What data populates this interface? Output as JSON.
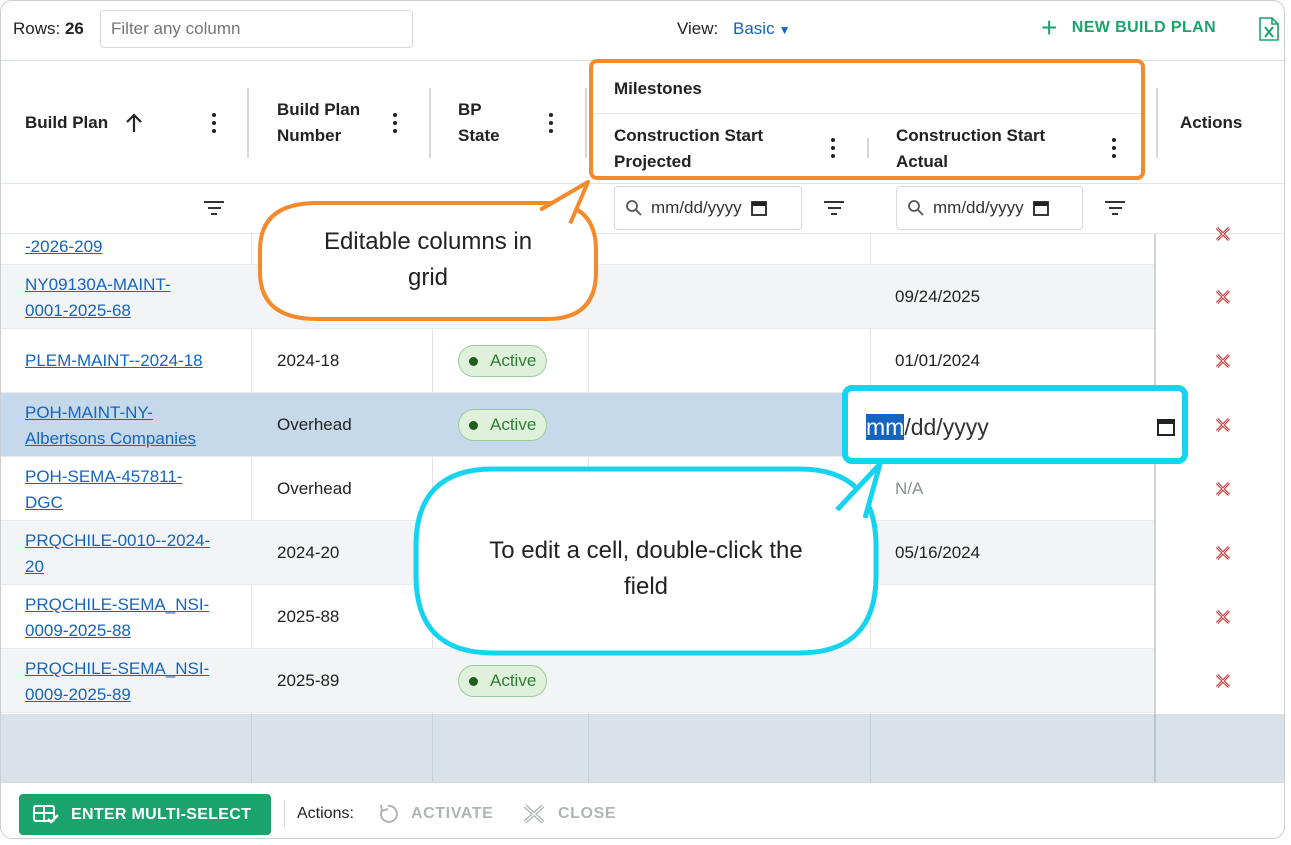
{
  "toolbar": {
    "rows_label": "Rows:",
    "rows_count": "26",
    "filter_placeholder": "Filter any column",
    "view_label": "View:",
    "view_value": "Basic",
    "new_build_label": "NEW BUILD PLAN"
  },
  "header": {
    "col_build_plan": "Build Plan",
    "col_build_plan_number_l1": "Build Plan",
    "col_build_plan_number_l2": "Number",
    "col_bp_state_l1": "BP",
    "col_bp_state_l2": "State",
    "group_milestones": "Milestones",
    "col_cs_projected_l1": "Construction Start",
    "col_cs_projected_l2": "Projected",
    "col_cs_actual_l1": "Construction Start",
    "col_cs_actual_l2": "Actual",
    "col_actions": "Actions"
  },
  "filters": {
    "date_placeholder": "mm/dd/yyyy"
  },
  "rows": [
    {
      "plan_l1": "-2026-209",
      "plan_l2": "",
      "number": "",
      "state": "",
      "projected": "",
      "actual": ""
    },
    {
      "plan_l1": "NY09130A-MAINT-",
      "plan_l2": "0001-2025-68",
      "number": "",
      "state": "",
      "projected": "",
      "actual": "09/24/2025"
    },
    {
      "plan_l1": "PLEM-MAINT--2024-18",
      "plan_l2": "",
      "number": "2024-18",
      "state": "Active",
      "projected": "",
      "actual": "01/01/2024"
    },
    {
      "plan_l1": "POH-MAINT-NY-",
      "plan_l2": "Albertsons Companies",
      "number": "Overhead",
      "state": "Active",
      "projected": "",
      "actual": ""
    },
    {
      "plan_l1": "POH-SEMA-457811-",
      "plan_l2": "DGC",
      "number": "Overhead",
      "state": "",
      "projected": "",
      "actual": "N/A"
    },
    {
      "plan_l1": "PRQCHILE-0010--2024-",
      "plan_l2": "20",
      "number": "2024-20",
      "state": "",
      "projected": "",
      "actual": "05/16/2024"
    },
    {
      "plan_l1": "PRQCHILE-SEMA_NSI-",
      "plan_l2": "0009-2025-88",
      "number": "2025-88",
      "state": "",
      "projected": "",
      "actual": ""
    },
    {
      "plan_l1": "PRQCHILE-SEMA_NSI-",
      "plan_l2": "0009-2025-89",
      "number": "2025-89",
      "state": "Active",
      "projected": "",
      "actual": ""
    }
  ],
  "edit_cell": {
    "highlighted": "mm",
    "rest": "/dd/yyyy"
  },
  "callouts": {
    "orange_l1": "Editable columns in",
    "orange_l2": "grid",
    "cyan_l1": "To edit a cell, double-click the",
    "cyan_l2": "field"
  },
  "footer": {
    "multi_select_label": "ENTER MULTI-SELECT",
    "actions_label": "Actions:",
    "activate_label": "ACTIVATE",
    "close_label": "CLOSE"
  },
  "colors": {
    "accent_green": "#1aa36b",
    "link_blue": "#1565c0",
    "callout_orange": "#f58a2c",
    "callout_cyan": "#16d4ef",
    "delete_red": "#d32f2f"
  }
}
